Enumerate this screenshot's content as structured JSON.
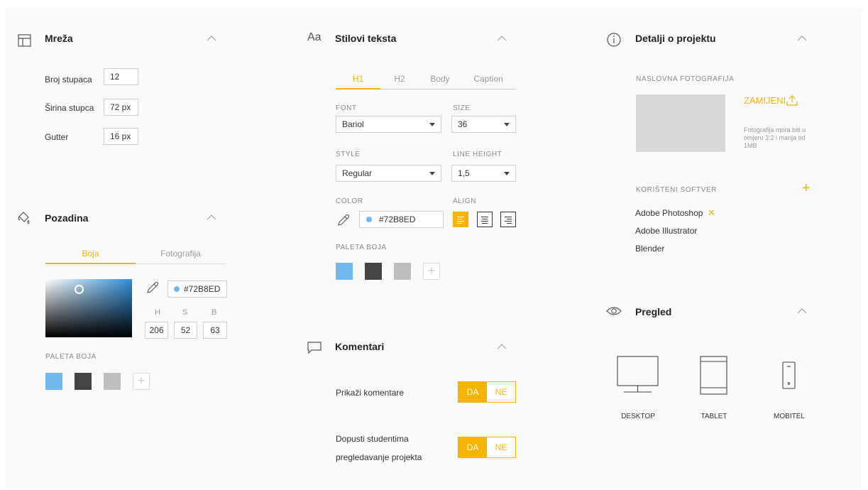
{
  "colors": {
    "accent": "#f5b400",
    "swatch_blue": "#72B8ED",
    "swatch_dark": "#444444",
    "swatch_gray": "#BCBEC0",
    "placeholder": "#d8d8d8"
  },
  "mreza": {
    "title": "Mreža",
    "fields": [
      {
        "label": "Broj stupaca",
        "value": "12"
      },
      {
        "label": "Širina stupca",
        "value": "72 px"
      },
      {
        "label": "Gutter",
        "value": "16 px"
      }
    ]
  },
  "pozadina": {
    "title": "Pozadina",
    "tabs": [
      "Boja",
      "Fotografija"
    ],
    "hex": "#72B8ED",
    "hsb_labels": [
      "H",
      "S",
      "B"
    ],
    "hsb_values": [
      "206",
      "52",
      "63"
    ],
    "palette_label": "PALETA BOJA",
    "add_label": "+"
  },
  "stilovi": {
    "icon_text": "Aa",
    "title": "Stilovi teksta",
    "tabs": [
      "H1",
      "H2",
      "Body",
      "Caption"
    ],
    "font_label": "FONT",
    "font_value": "Bariol",
    "size_label": "SIZE",
    "size_value": "36",
    "style_label": "STYLE",
    "style_value": "Regular",
    "line_height_label": "LINE HEIGHT",
    "line_height_value": "1,5",
    "color_label": "COLOR",
    "color_value": "#72B8ED",
    "align_label": "ALIGN",
    "palette_label": "PALETA BOJA",
    "add_label": "+"
  },
  "komentari": {
    "title": "Komentari",
    "row1_label": "Prikaži komentare",
    "row2_label_line1": "Dopusti studentima",
    "row2_label_line2": "pregledavanje projekta",
    "yes": "DA",
    "no": "NE"
  },
  "detalji": {
    "title": "Detalji o projektu",
    "photo_label": "NASLOVNA FOTOGRAFIJA",
    "replace_label": "ZAMIJENI",
    "photo_hint_1": "Fotografija mora biti u",
    "photo_hint_2": "omjeru 3:2 i manja od",
    "photo_hint_3": "1MB",
    "software_label": "KORIŠTENI SOFTVER",
    "add_label": "+",
    "remove_label": "✕",
    "software": [
      "Adobe Photoshop",
      "Adobe Illustrator",
      "Blender"
    ]
  },
  "pregled": {
    "title": "Pregled",
    "devices": [
      "DESKTOP",
      "TABLET",
      "MOBITEL"
    ]
  }
}
